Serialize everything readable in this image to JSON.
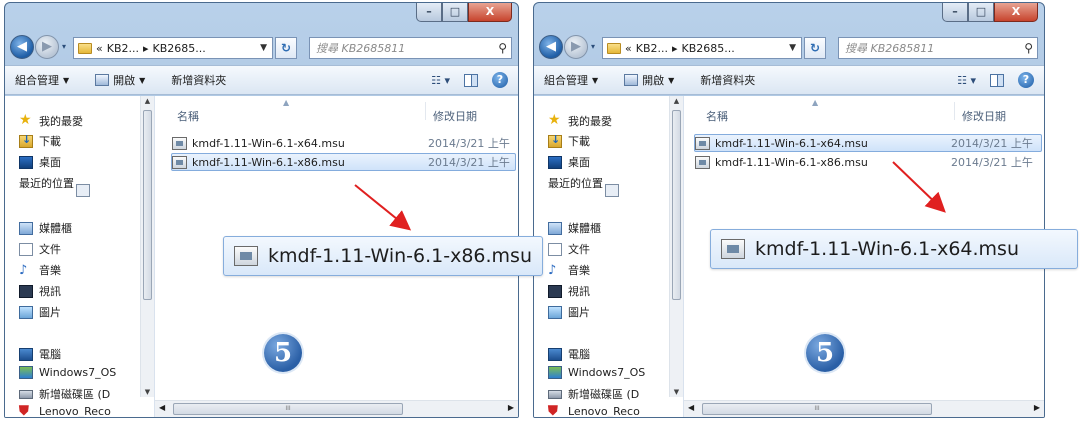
{
  "windows": [
    {
      "id": "left",
      "title_controls": {
        "minimize": "–",
        "maximize": "□",
        "close": "X"
      },
      "address": {
        "recent": "▾",
        "crumb1": "KB2...",
        "crumb2": "KB2685...",
        "prefix": "«"
      },
      "search": {
        "placeholder": "搜尋 KB2685811"
      },
      "toolbar": {
        "organize": "組合管理",
        "open": "開啟",
        "new_folder": "新增資料夾"
      },
      "nav": {
        "favorites": "我的最愛",
        "downloads": "下載",
        "desktop": "桌面",
        "recent": "最近的位置",
        "libraries": "媒體櫃",
        "documents": "文件",
        "music": "音樂",
        "videos": "視訊",
        "pictures": "圖片",
        "computer": "電腦",
        "drive_c": "Windows7_OS",
        "drive_d": "新增磁碟區 (D",
        "drive_recovery": "Lenovo_Reco"
      },
      "columns": {
        "name": "名稱",
        "date": "修改日期"
      },
      "files": [
        {
          "name": "kmdf-1.11-Win-6.1-x64.msu",
          "date": "2014/3/21 上午",
          "selected": false
        },
        {
          "name": "kmdf-1.11-Win-6.1-x86.msu",
          "date": "2014/3/21 上午",
          "selected": true
        }
      ],
      "callout": "kmdf-1.11-Win-6.1-x86.msu",
      "step_badge": "5"
    },
    {
      "id": "right",
      "title_controls": {
        "minimize": "–",
        "maximize": "□",
        "close": "X"
      },
      "address": {
        "recent": "▾",
        "crumb1": "KB2...",
        "crumb2": "KB2685...",
        "prefix": "«"
      },
      "search": {
        "placeholder": "搜尋 KB2685811"
      },
      "toolbar": {
        "organize": "組合管理",
        "open": "開啟",
        "new_folder": "新增資料夾"
      },
      "nav": {
        "favorites": "我的最愛",
        "downloads": "下載",
        "desktop": "桌面",
        "recent": "最近的位置",
        "libraries": "媒體櫃",
        "documents": "文件",
        "music": "音樂",
        "videos": "視訊",
        "pictures": "圖片",
        "computer": "電腦",
        "drive_c": "Windows7_OS",
        "drive_d": "新增磁碟區 (D",
        "drive_recovery": "Lenovo_Reco"
      },
      "columns": {
        "name": "名稱",
        "date": "修改日期"
      },
      "files": [
        {
          "name": "kmdf-1.11-Win-6.1-x64.msu",
          "date": "2014/3/21 上午",
          "selected": true
        },
        {
          "name": "kmdf-1.11-Win-6.1-x86.msu",
          "date": "2014/3/21 上午",
          "selected": false
        }
      ],
      "callout": "kmdf-1.11-Win-6.1-x64.msu",
      "step_badge": "5"
    }
  ],
  "colors": {
    "arrow": "#e02020",
    "selection": "#cfe3fa",
    "badge": "#2a5fa6"
  }
}
